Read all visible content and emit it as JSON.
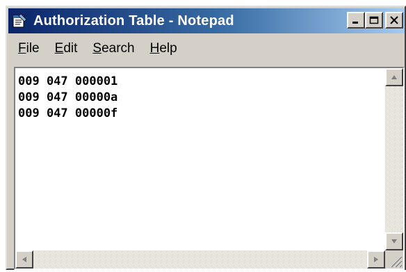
{
  "window": {
    "title": "Authorization Table - Notepad",
    "icon": "notepad-icon"
  },
  "title_buttons": {
    "minimize_icon": "minimize-icon",
    "maximize_icon": "maximize-icon",
    "close_icon": "close-icon"
  },
  "menu": {
    "items": [
      {
        "accel": "F",
        "rest": "ile"
      },
      {
        "accel": "E",
        "rest": "dit"
      },
      {
        "accel": "S",
        "rest": "earch"
      },
      {
        "accel": "H",
        "rest": "elp"
      }
    ]
  },
  "document": {
    "lines": [
      "009 047 000001",
      "009 047 00000a",
      "009 047 00000f"
    ]
  },
  "colors": {
    "titlebar_start": "#0a246a",
    "titlebar_end": "#a6caf0",
    "chrome": "#d4d0c8"
  }
}
